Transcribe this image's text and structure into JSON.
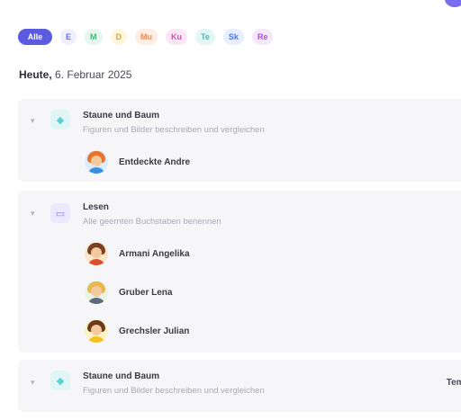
{
  "filters": [
    {
      "label": "Alle",
      "bg": "#5b5be0",
      "fg": "#ffffff"
    },
    {
      "label": "E",
      "bg": "#eef0ff",
      "fg": "#6c6cf0"
    },
    {
      "label": "M",
      "bg": "#e6f6ee",
      "fg": "#3dbb7a"
    },
    {
      "label": "D",
      "bg": "#fff6dc",
      "fg": "#e0a820"
    },
    {
      "label": "Mu",
      "bg": "#ffece2",
      "fg": "#f08a4a"
    },
    {
      "label": "Ku",
      "bg": "#fbe6f6",
      "fg": "#d84cc0"
    },
    {
      "label": "Te",
      "bg": "#e3f7f7",
      "fg": "#3cbcbc"
    },
    {
      "label": "Sk",
      "bg": "#e6eeff",
      "fg": "#4a78f0"
    },
    {
      "label": "Re",
      "bg": "#f5e8fb",
      "fg": "#b04ae0"
    }
  ],
  "date": {
    "day": "Heute,",
    "rest": " 6. Februar 2025"
  },
  "groups": [
    {
      "title": "Staune und Baum",
      "subtitle": "Figuren und Bilder beschreiben und vergleichen",
      "icon": "bulb-icon",
      "icon_color": "#5ccfcf",
      "members": [
        "Entdeckte Andre"
      ]
    },
    {
      "title": "Lesen",
      "subtitle": "Alle geernten Buchstaben benennen",
      "icon": "book-icon",
      "icon_color": "#8a7cf0",
      "members": [
        "Armani Angelika",
        "Gruber Lena",
        "Grechsler Julian"
      ]
    },
    {
      "title": "Staune und Baum",
      "subtitle": "Figuren und Bilder beschreiben und vergleichen",
      "icon": "bulb-icon",
      "icon_color": "#5ccfcf",
      "right_label": "Tempel"
    }
  ],
  "colors": {
    "accent": "#5b5be0",
    "group_bg": "#f6f6f8"
  }
}
